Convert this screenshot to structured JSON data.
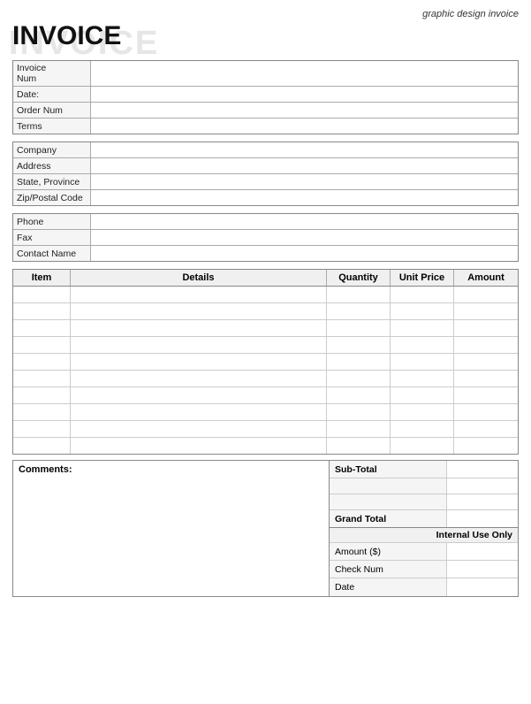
{
  "header": {
    "watermark": "INVOICE",
    "subtitle": "graphic design invoice",
    "title": "INVOICE"
  },
  "info_section1": {
    "rows": [
      {
        "label": "Invoice Num",
        "value": ""
      },
      {
        "label": "Date:",
        "value": ""
      },
      {
        "label": "Order Num",
        "value": ""
      },
      {
        "label": "Terms",
        "value": ""
      }
    ]
  },
  "info_section2": {
    "rows": [
      {
        "label": "Company",
        "value": ""
      },
      {
        "label": "Address",
        "value": ""
      },
      {
        "label": "State, Province",
        "value": ""
      },
      {
        "label": "Zip/Postal Code",
        "value": ""
      }
    ]
  },
  "info_section3": {
    "rows": [
      {
        "label": "Phone",
        "value": ""
      },
      {
        "label": "Fax",
        "value": ""
      },
      {
        "label": "Contact Name",
        "value": ""
      }
    ]
  },
  "table": {
    "headers": {
      "item": "Item",
      "details": "Details",
      "quantity": "Quantity",
      "unit_price": "Unit Price",
      "amount": "Amount"
    },
    "rows": [
      {
        "item": "",
        "details": "",
        "quantity": "",
        "unit_price": "",
        "amount": ""
      },
      {
        "item": "",
        "details": "",
        "quantity": "",
        "unit_price": "",
        "amount": ""
      },
      {
        "item": "",
        "details": "",
        "quantity": "",
        "unit_price": "",
        "amount": ""
      },
      {
        "item": "",
        "details": "",
        "quantity": "",
        "unit_price": "",
        "amount": ""
      },
      {
        "item": "",
        "details": "",
        "quantity": "",
        "unit_price": "",
        "amount": ""
      },
      {
        "item": "",
        "details": "",
        "quantity": "",
        "unit_price": "",
        "amount": ""
      },
      {
        "item": "",
        "details": "",
        "quantity": "",
        "unit_price": "",
        "amount": ""
      },
      {
        "item": "",
        "details": "",
        "quantity": "",
        "unit_price": "",
        "amount": ""
      },
      {
        "item": "",
        "details": "",
        "quantity": "",
        "unit_price": "",
        "amount": ""
      },
      {
        "item": "",
        "details": "",
        "quantity": "",
        "unit_price": "",
        "amount": ""
      }
    ]
  },
  "comments_label": "Comments:",
  "totals": {
    "subtotal_label": "Sub-Total",
    "spacer1": "",
    "spacer2": "",
    "grand_total_label": "Grand Total",
    "internal_use_label": "Internal Use Only",
    "amount_label": "Amount ($)",
    "check_num_label": "Check Num",
    "date_label": "Date"
  }
}
